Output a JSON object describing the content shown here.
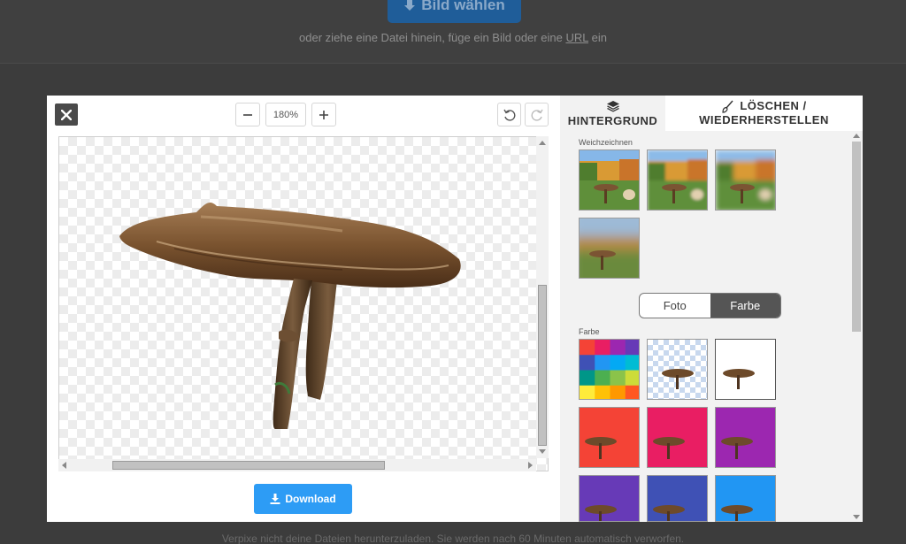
{
  "background_page": {
    "upload_label": "Bild wählen",
    "hint_prefix": "oder ziehe eine Datei hinein, füge ein Bild oder eine",
    "hint_link": "URL",
    "hint_suffix": "ein",
    "footer_text": "Verpixe nicht deine Dateien herunterzuladen. Sie werden nach 60 Minuten automatisch verworfen."
  },
  "editor": {
    "zoom_value": "180%",
    "download_label": "Download",
    "icons": {
      "close": "close-icon",
      "zoom_out": "minus-icon",
      "zoom_in": "plus-icon",
      "undo": "undo-icon",
      "redo": "redo-icon",
      "download": "download-icon"
    }
  },
  "panel": {
    "tabs": [
      {
        "label": "HINTERGRUND",
        "icon": "layers-icon",
        "active": false
      },
      {
        "label_line1": "LÖSCHEN /",
        "label_line2": "WIEDERHERSTELLEN",
        "icon": "brush-icon",
        "active": true
      }
    ],
    "blur_section_label": "Weichzeichnen",
    "toggle": {
      "option1": "Foto",
      "option2": "Farbe",
      "selected": "Farbe"
    },
    "color_section_label": "Farbe",
    "color_swatches": [
      "#f44336",
      "#e91e63",
      "#9c27b0",
      "#673ab7",
      "#3f51b5",
      "#2196f3"
    ],
    "palette_colors": [
      "#f44336",
      "#e91e63",
      "#9c27b0",
      "#673ab7",
      "#3f51b5",
      "#2196f3",
      "#03a9f4",
      "#00bcd4",
      "#009688",
      "#4caf50",
      "#8bc34a",
      "#cddc39",
      "#ffeb3b",
      "#ffc107",
      "#ff9800",
      "#ff5722"
    ]
  }
}
